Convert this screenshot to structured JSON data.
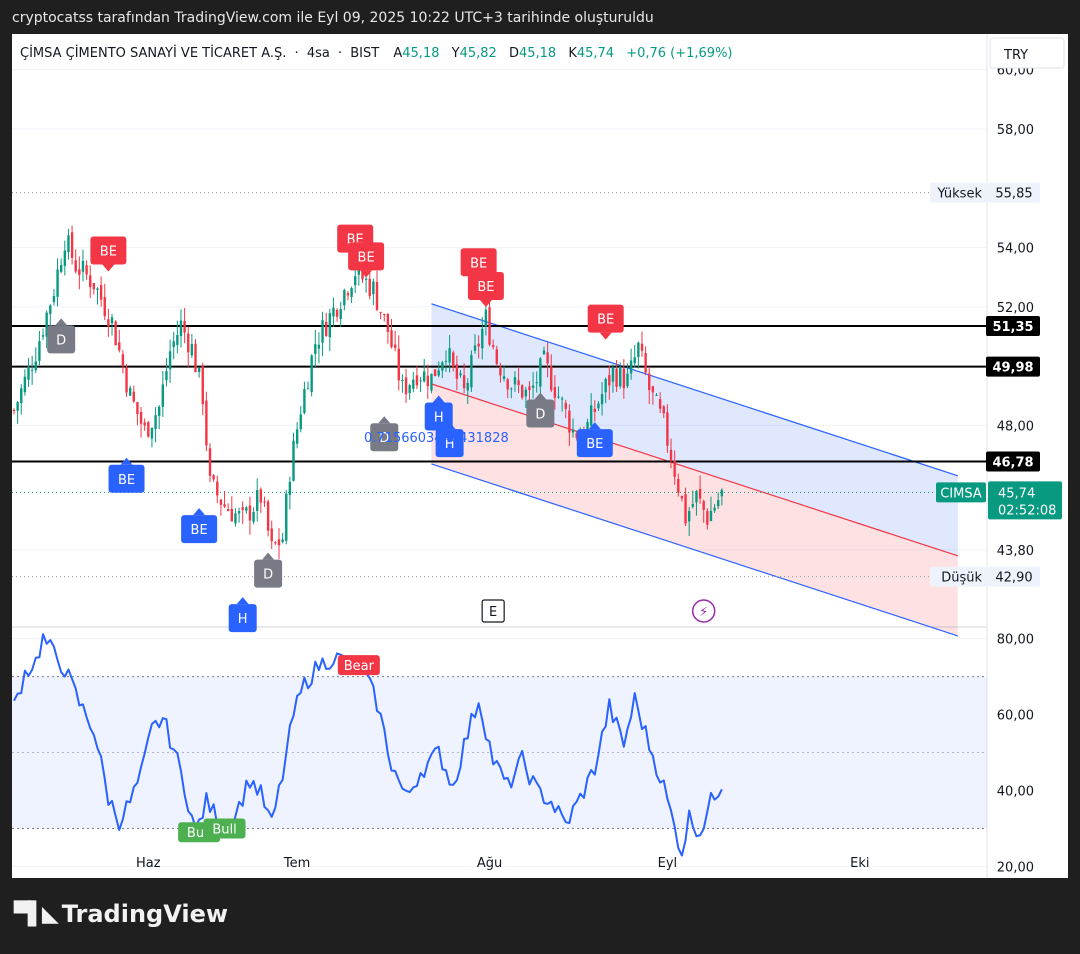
{
  "caption": "cryptocatss tarafından TradingView.com ile Eyl 09, 2025 10:22 UTC+3 tarihinde oluşturuldu",
  "header": {
    "name": "ÇİMSA ÇİMENTO SANAYİ VE TİCARET A.Ş.",
    "interval": "4sa",
    "exchange": "BIST",
    "open_label": "A",
    "open": "45,18",
    "high_label": "Y",
    "high": "45,82",
    "low_label": "D",
    "low": "45,18",
    "close_label": "K",
    "close": "45,74",
    "change": "+0,76 (+1,69%)",
    "currency": "TRY"
  },
  "footer": {
    "brand": "TradingView"
  },
  "colors": {
    "up": "#089981",
    "down": "#f23645",
    "channel_blue": "#2962ff",
    "channel_red": "#f23645",
    "rsi_line": "#2962ff",
    "be_label": "#f23645",
    "bull_label": "#4caf50",
    "bear_label": "#f23645",
    "h_label": "#2962ff",
    "d_label": "#787b86"
  },
  "chart_data": [
    {
      "type": "candlestick",
      "panel": "price",
      "x_labels": [
        "Haz",
        "Tem",
        "Ağu",
        "Eyl",
        "Eki"
      ],
      "y_ticks": [
        "60,00",
        "58,00",
        "54,00",
        "52,00",
        "48,00",
        "43,80"
      ],
      "ylim": [
        41.2,
        61.2
      ],
      "price_anchors": [
        {
          "x": 0,
          "y": 48.5
        },
        {
          "x": 6,
          "y": 50.5
        },
        {
          "x": 11,
          "y": 52.6
        },
        {
          "x": 14,
          "y": 54.3
        },
        {
          "x": 17,
          "y": 53.4
        },
        {
          "x": 22,
          "y": 52.8
        },
        {
          "x": 27,
          "y": 51.5
        },
        {
          "x": 32,
          "y": 49.0
        },
        {
          "x": 36,
          "y": 47.8
        },
        {
          "x": 40,
          "y": 48.6
        },
        {
          "x": 43,
          "y": 50.5
        },
        {
          "x": 46,
          "y": 51.4
        },
        {
          "x": 49,
          "y": 50.6
        },
        {
          "x": 52,
          "y": 49.0
        },
        {
          "x": 54,
          "y": 46.0
        },
        {
          "x": 58,
          "y": 45.3
        },
        {
          "x": 63,
          "y": 44.8
        },
        {
          "x": 68,
          "y": 45.6
        },
        {
          "x": 71,
          "y": 43.8
        },
        {
          "x": 74,
          "y": 44.2
        },
        {
          "x": 76,
          "y": 46.5
        },
        {
          "x": 79,
          "y": 48.6
        },
        {
          "x": 83,
          "y": 50.8
        },
        {
          "x": 89,
          "y": 52.1
        },
        {
          "x": 94,
          "y": 53.2
        },
        {
          "x": 99,
          "y": 52.6
        },
        {
          "x": 103,
          "y": 51.2
        },
        {
          "x": 107,
          "y": 49.2
        },
        {
          "x": 111,
          "y": 49.8
        },
        {
          "x": 115,
          "y": 49.6
        },
        {
          "x": 119,
          "y": 50.6
        },
        {
          "x": 121,
          "y": 49.8
        },
        {
          "x": 124,
          "y": 49.1
        },
        {
          "x": 127,
          "y": 50.4
        },
        {
          "x": 130,
          "y": 51.6
        },
        {
          "x": 133,
          "y": 50.2
        },
        {
          "x": 137,
          "y": 49.4
        },
        {
          "x": 142,
          "y": 49.0
        },
        {
          "x": 146,
          "y": 50.1
        },
        {
          "x": 150,
          "y": 49.0
        },
        {
          "x": 154,
          "y": 47.8
        },
        {
          "x": 157,
          "y": 47.7
        },
        {
          "x": 161,
          "y": 48.8
        },
        {
          "x": 165,
          "y": 49.8
        },
        {
          "x": 169,
          "y": 49.5
        },
        {
          "x": 172,
          "y": 50.6
        },
        {
          "x": 175,
          "y": 49.2
        },
        {
          "x": 179,
          "y": 48.0
        },
        {
          "x": 182,
          "y": 46.5
        },
        {
          "x": 185,
          "y": 44.9
        },
        {
          "x": 188,
          "y": 45.6
        },
        {
          "x": 191,
          "y": 44.9
        },
        {
          "x": 195,
          "y": 45.7
        }
      ],
      "horizontal_lines": [
        {
          "label": "51,35",
          "y": 51.35
        },
        {
          "label": "49,98",
          "y": 49.98
        },
        {
          "label": "46,78",
          "y": 46.78
        }
      ],
      "price_marks": [
        {
          "label": "Yüksek",
          "value": "55,85",
          "y": 55.85
        },
        {
          "label": "Düşük",
          "value": "42,90",
          "y": 42.9
        }
      ],
      "current": {
        "symbol": "CIMSA",
        "price": "45,74",
        "countdown": "02:52:08",
        "y": 45.74
      },
      "channel": {
        "start": {
          "x": 115,
          "y": 52.1
        },
        "upper_end": {
          "x": 260,
          "y": 46.3
        },
        "mid_end": {
          "x": 260,
          "y": 43.6
        },
        "lower_end": {
          "x": 260,
          "y": 40.9
        }
      },
      "fib_annotation": "0.7156603448431828",
      "signals": [
        {
          "label": "BE",
          "kind": "be",
          "x": 26,
          "y": 53.9
        },
        {
          "label": "BE",
          "kind": "be",
          "x": 94,
          "y": 54.3
        },
        {
          "label": "BE",
          "kind": "be",
          "x": 97,
          "y": 53.7
        },
        {
          "label": "BE",
          "kind": "be",
          "x": 128,
          "y": 53.5
        },
        {
          "label": "BE",
          "kind": "be",
          "x": 130,
          "y": 52.7
        },
        {
          "label": "BE",
          "kind": "be",
          "x": 163,
          "y": 51.6
        },
        {
          "label": "D",
          "kind": "d",
          "x": 13,
          "y": 50.9
        },
        {
          "label": "D",
          "kind": "d",
          "x": 102,
          "y": 47.6
        },
        {
          "label": "D",
          "kind": "d",
          "x": 145,
          "y": 48.4
        },
        {
          "label": "D",
          "kind": "d",
          "x": 70,
          "y": 43.0
        },
        {
          "label": "BE",
          "kind": "bue",
          "x": 31,
          "y": 46.2
        },
        {
          "label": "BE",
          "kind": "bue",
          "x": 51,
          "y": 44.5
        },
        {
          "label": "BE",
          "kind": "bue",
          "x": 160,
          "y": 47.4
        },
        {
          "label": "H",
          "kind": "h",
          "x": 117,
          "y": 48.3
        },
        {
          "label": "H",
          "kind": "h",
          "x": 120,
          "y": 47.4
        },
        {
          "label": "H",
          "kind": "h",
          "x": 63,
          "y": 41.5
        }
      ],
      "events": [
        {
          "label": "E",
          "kind": "earnings",
          "x": 132
        },
        {
          "label": "⚡",
          "kind": "flash",
          "x": 190
        }
      ]
    },
    {
      "type": "line",
      "panel": "rsi",
      "y_ticks": [
        "80,00",
        "60,00",
        "40,00",
        "20,00"
      ],
      "ylim": [
        18,
        82
      ],
      "band": [
        30,
        70
      ],
      "midline": 50,
      "rsi_anchors": [
        {
          "x": 0,
          "y": 62
        },
        {
          "x": 3,
          "y": 71
        },
        {
          "x": 6,
          "y": 74
        },
        {
          "x": 8,
          "y": 80
        },
        {
          "x": 11,
          "y": 76
        },
        {
          "x": 14,
          "y": 72
        },
        {
          "x": 18,
          "y": 63
        },
        {
          "x": 22,
          "y": 56
        },
        {
          "x": 26,
          "y": 38
        },
        {
          "x": 29,
          "y": 32
        },
        {
          "x": 32,
          "y": 37
        },
        {
          "x": 35,
          "y": 44
        },
        {
          "x": 38,
          "y": 56
        },
        {
          "x": 41,
          "y": 59
        },
        {
          "x": 44,
          "y": 51
        },
        {
          "x": 47,
          "y": 41
        },
        {
          "x": 50,
          "y": 29
        },
        {
          "x": 53,
          "y": 37
        },
        {
          "x": 56,
          "y": 33
        },
        {
          "x": 59,
          "y": 30
        },
        {
          "x": 62,
          "y": 36
        },
        {
          "x": 65,
          "y": 43
        },
        {
          "x": 68,
          "y": 39
        },
        {
          "x": 71,
          "y": 31
        },
        {
          "x": 74,
          "y": 44
        },
        {
          "x": 77,
          "y": 60
        },
        {
          "x": 80,
          "y": 68
        },
        {
          "x": 84,
          "y": 73
        },
        {
          "x": 88,
          "y": 75
        },
        {
          "x": 92,
          "y": 74
        },
        {
          "x": 96,
          "y": 72
        },
        {
          "x": 100,
          "y": 63
        },
        {
          "x": 104,
          "y": 47
        },
        {
          "x": 108,
          "y": 38
        },
        {
          "x": 112,
          "y": 45
        },
        {
          "x": 117,
          "y": 50
        },
        {
          "x": 121,
          "y": 41
        },
        {
          "x": 124,
          "y": 52
        },
        {
          "x": 128,
          "y": 64
        },
        {
          "x": 132,
          "y": 48
        },
        {
          "x": 136,
          "y": 41
        },
        {
          "x": 140,
          "y": 48
        },
        {
          "x": 144,
          "y": 40
        },
        {
          "x": 148,
          "y": 37
        },
        {
          "x": 152,
          "y": 31
        },
        {
          "x": 156,
          "y": 38
        },
        {
          "x": 160,
          "y": 46
        },
        {
          "x": 164,
          "y": 62
        },
        {
          "x": 168,
          "y": 52
        },
        {
          "x": 171,
          "y": 64
        },
        {
          "x": 175,
          "y": 52
        },
        {
          "x": 179,
          "y": 41
        },
        {
          "x": 182,
          "y": 30
        },
        {
          "x": 184,
          "y": 24
        },
        {
          "x": 186,
          "y": 33
        },
        {
          "x": 189,
          "y": 29
        },
        {
          "x": 192,
          "y": 37
        },
        {
          "x": 195,
          "y": 42
        }
      ],
      "signals": [
        {
          "label": "Bull",
          "kind": "bull",
          "x": 51,
          "y": 29
        },
        {
          "label": "Bull",
          "kind": "bull",
          "x": 58,
          "y": 30
        },
        {
          "label": "Bear",
          "kind": "bear",
          "x": 95,
          "y": 73
        }
      ]
    }
  ]
}
